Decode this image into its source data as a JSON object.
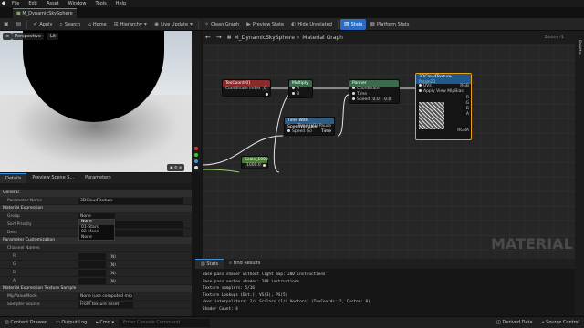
{
  "menu": [
    "File",
    "Edit",
    "Asset",
    "Window",
    "Tools",
    "Help"
  ],
  "doc_tab": "M_DynamicSkySphere",
  "toolbar": {
    "apply": "Apply",
    "search": "Search",
    "home": "Home",
    "hierarchy": "Hierarchy",
    "live_update": "Live Update",
    "clean_graph": "Clean Graph",
    "preview_state": "Preview State",
    "hide_unrelated": "Hide Unrelated",
    "stats": "Stats",
    "platform_stats": "Platform Stats"
  },
  "viewport": {
    "perspective": "Perspective",
    "lit": "Lit"
  },
  "details_tabs": [
    "Details",
    "Preview Scene S...",
    "Parameters"
  ],
  "details": {
    "general": "General",
    "parameter_name_label": "Parameter Name",
    "parameter_name_value": "3DCloudTexture",
    "material_expression": "Material Expression",
    "group_label": "Group",
    "group_value": "None",
    "sort_priority_label": "Sort Priority",
    "desc_label": "Desc",
    "param_customization": "Parameter Customization",
    "channel_names": "Channel Names",
    "channels": [
      "R",
      "G",
      "B",
      "A"
    ],
    "channel_value": "(N)",
    "texture_sample": "Material Expression Texture Sample",
    "mip_value_mode_label": "MipValueMode",
    "mip_value_mode_value": "None (use computed mip level)",
    "sampler_source_label": "Sampler Source",
    "sampler_source_value": "From texture asset"
  },
  "dropdown": [
    "None",
    "01-Stars",
    "02-Moon",
    "None"
  ],
  "graph": {
    "breadcrumb_root": "M_DynamicSkySphere",
    "breadcrumb_leaf": "Material Graph",
    "zoom": "Zoom -1",
    "watermark": "MATERIAL",
    "palette": "Palette",
    "nodes": {
      "texcoord": {
        "title": "TexCoord[0]",
        "pin": "Coordinate Index",
        "value": "0"
      },
      "multiply": {
        "title": "Multiply",
        "a": "A",
        "b": "B"
      },
      "panner": {
        "title": "Panner",
        "coord": "Coordinate",
        "time": "Time",
        "speed": "Speed",
        "sx": "0.0",
        "sy": "0.0"
      },
      "time_speed": {
        "title": "Time With SpeedVariable",
        "time": "Time (V3)",
        "pause": "Pause Time",
        "speed": "Speed (S)",
        "out": "Time"
      },
      "scalar": {
        "title": "Scale_1000",
        "value": "1000.0"
      },
      "texparam": {
        "title": "3DCloudTexture",
        "subtitle": "Param2D",
        "uvs": "UVs",
        "apply_mip": "Apply View MipBias",
        "rgb": "RGB",
        "r": "R",
        "g": "G",
        "b": "B",
        "a": "A",
        "rgba": "RGBA"
      }
    }
  },
  "stats_tabs": [
    "Stats",
    "Find Results"
  ],
  "stats_lines": [
    "Base pass shader without light map: 200 instructions",
    "Base pass vertex shader: 249 instructions",
    "Texture samplers: 5/16",
    "Texture Lookups (Est.): VS(3), PS(5)",
    "User interpolators: 2/4 Scalars (1/4 Vectors) (TexCoords: 2, Custom: 0)",
    "Shader Count: 4"
  ],
  "statusbar": {
    "content_drawer": "Content Drawer",
    "output_log": "Output Log",
    "cmd": "Cmd",
    "cmd_placeholder": "Enter Console Command",
    "derived": "Derived Data",
    "source_control": "Source Control"
  },
  "colors": {
    "accent": "#3a8fdc",
    "texcoord_header": "#8a2a2a",
    "multiply_header": "#3b6b4a",
    "panner_header": "#3b6b4a",
    "func_header": "#2a5d8a",
    "scalar_header": "#4b7a3b",
    "texparam_header": "#1f5a8e",
    "texparam_border": "#e8a01a"
  }
}
